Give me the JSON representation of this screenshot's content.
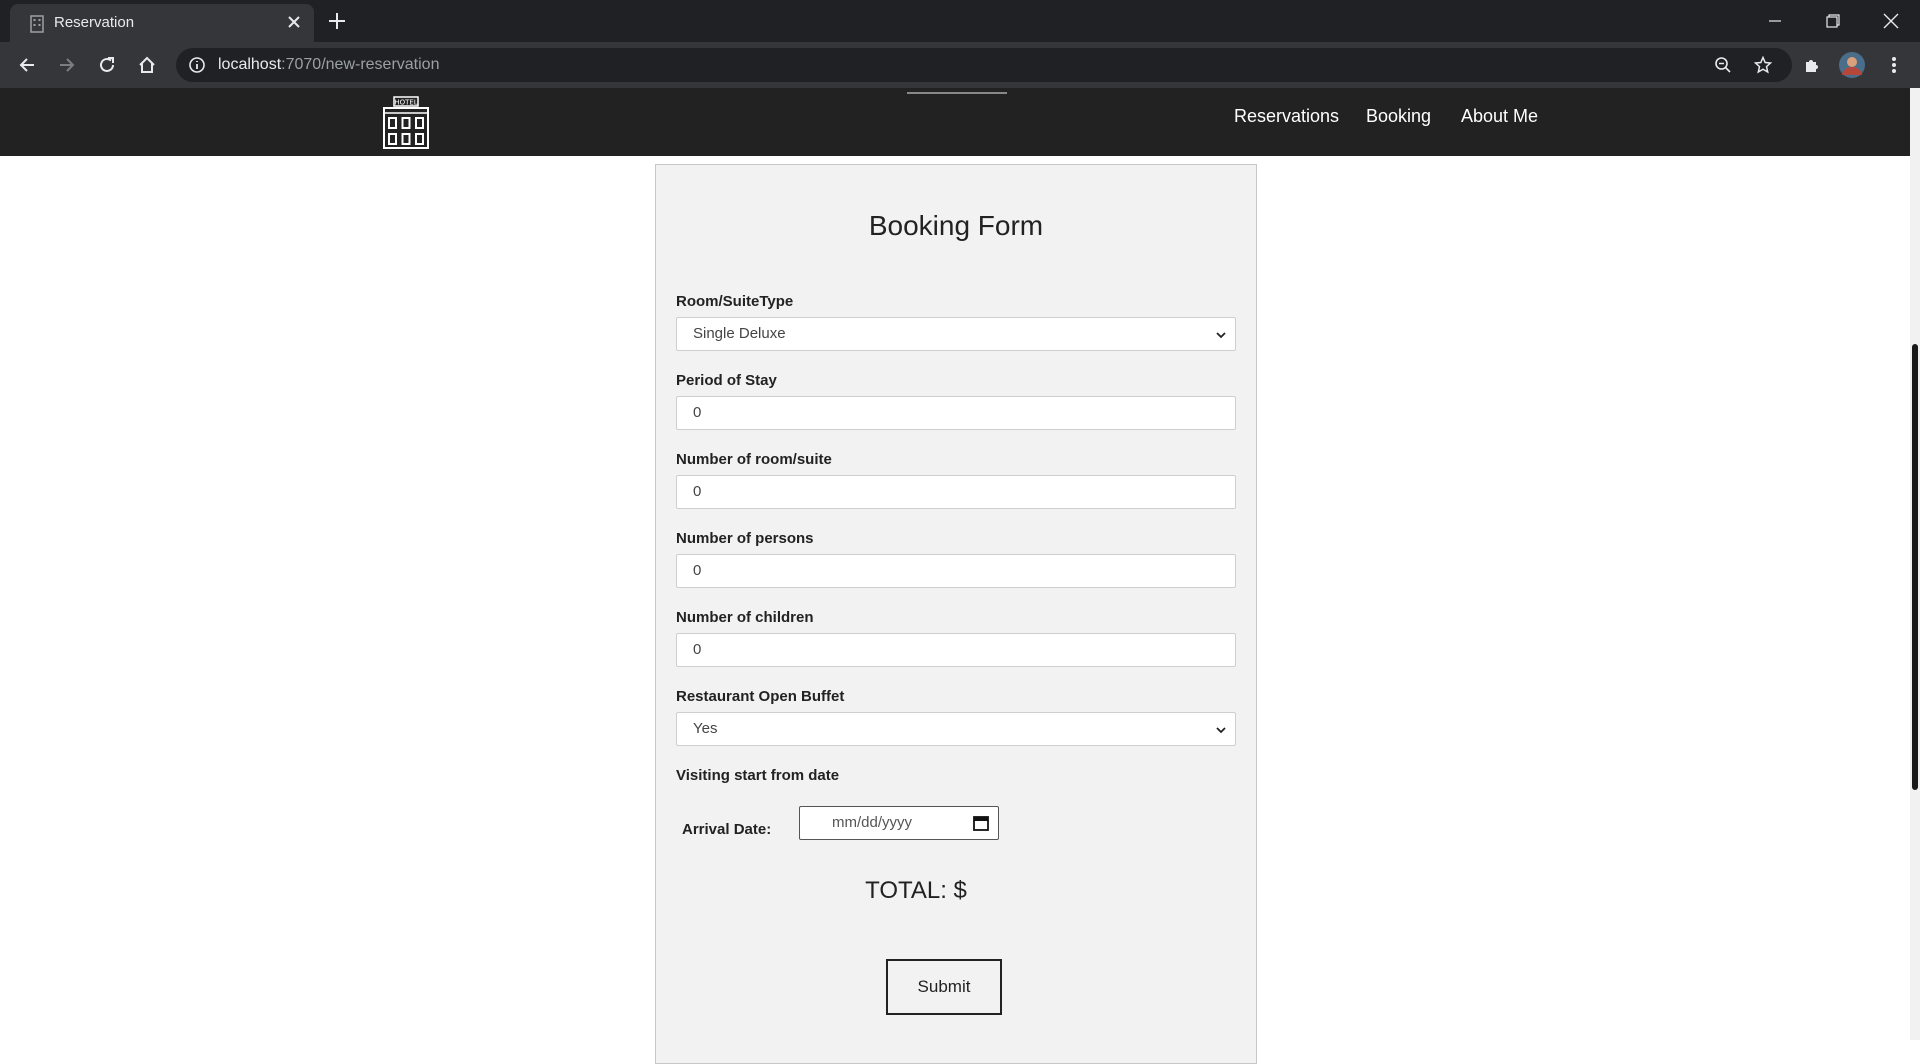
{
  "browser": {
    "tab_title": "Reservation",
    "url_host": "localhost",
    "url_path": ":7070/new-reservation"
  },
  "site": {
    "logo_text": "HOTEL",
    "nav": [
      "Reservations",
      "Booking",
      "About Me"
    ]
  },
  "form": {
    "title": "Booking Form",
    "room_type": {
      "label": "Room/SuiteType",
      "value": "Single Deluxe"
    },
    "period": {
      "label": "Period of Stay",
      "value": "0"
    },
    "rooms": {
      "label": "Number of room/suite",
      "value": "0"
    },
    "persons": {
      "label": "Number of persons",
      "value": "0"
    },
    "children": {
      "label": "Number of children",
      "value": "0"
    },
    "buffet": {
      "label": "Restaurant Open Buffet",
      "value": "Yes"
    },
    "visiting_label": "Visiting start from date",
    "arrival": {
      "label": "Arrival Date:",
      "placeholder": "mm/dd/yyyy"
    },
    "total_label": "TOTAL: $",
    "submit_label": "Submit"
  }
}
